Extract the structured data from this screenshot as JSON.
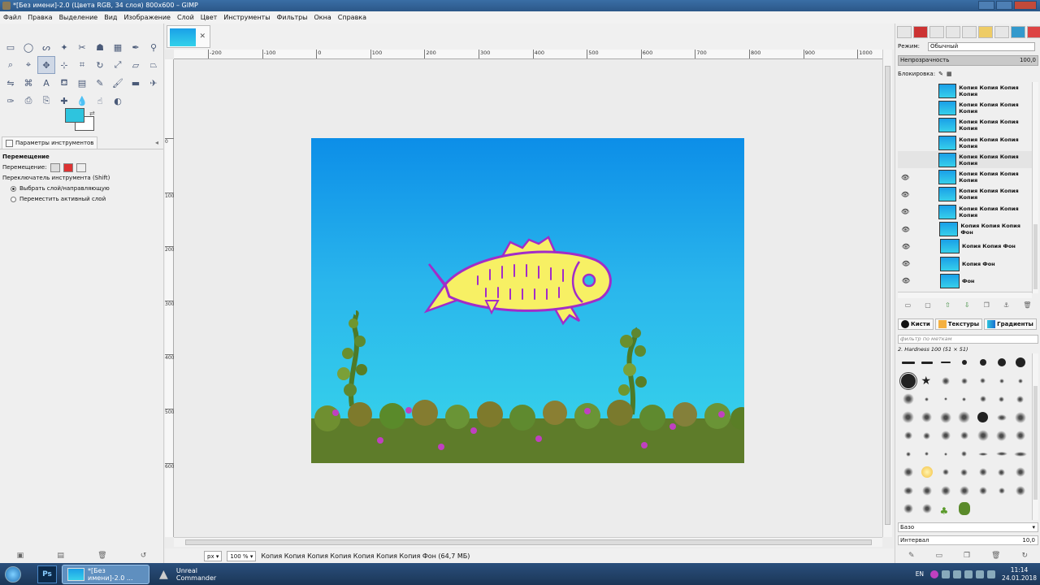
{
  "window": {
    "title": "*[Без имени]-2.0 (Цвета RGB, 34 слоя) 800x600 – GIMP"
  },
  "menu": [
    "Файл",
    "Правка",
    "Выделение",
    "Вид",
    "Изображение",
    "Слой",
    "Цвет",
    "Инструменты",
    "Фильтры",
    "Окна",
    "Справка"
  ],
  "toolbox": {
    "tools": [
      {
        "name": "rect-select-tool-icon",
        "glyph": "▭"
      },
      {
        "name": "ellipse-select-tool-icon",
        "glyph": "◯"
      },
      {
        "name": "free-select-tool-icon",
        "glyph": "ᔕ"
      },
      {
        "name": "fuzzy-select-tool-icon",
        "glyph": "✦"
      },
      {
        "name": "scissors-tool-icon",
        "glyph": "✂"
      },
      {
        "name": "foreground-select-tool-icon",
        "glyph": "☗"
      },
      {
        "name": "select-by-color-tool-icon",
        "glyph": "▦"
      },
      {
        "name": "paths-tool-icon",
        "glyph": "✒"
      },
      {
        "name": "color-picker-tool-icon",
        "glyph": "⚲"
      },
      {
        "name": "zoom-tool-icon",
        "glyph": "⌕"
      },
      {
        "name": "measure-tool-icon",
        "glyph": "⌖"
      },
      {
        "name": "move-tool-icon",
        "glyph": "✥"
      },
      {
        "name": "align-tool-icon",
        "glyph": "⊹"
      },
      {
        "name": "crop-tool-icon",
        "glyph": "⌗"
      },
      {
        "name": "rotate-tool-icon",
        "glyph": "↻"
      },
      {
        "name": "scale-tool-icon",
        "glyph": "⤢"
      },
      {
        "name": "shear-tool-icon",
        "glyph": "▱"
      },
      {
        "name": "perspective-tool-icon",
        "glyph": "⏢"
      },
      {
        "name": "flip-tool-icon",
        "glyph": "⇋"
      },
      {
        "name": "cage-tool-icon",
        "glyph": "⌘"
      },
      {
        "name": "text-tool-icon",
        "glyph": "A"
      },
      {
        "name": "bucket-fill-tool-icon",
        "glyph": "⛾"
      },
      {
        "name": "blend-tool-icon",
        "glyph": "▤"
      },
      {
        "name": "pencil-tool-icon",
        "glyph": "✎"
      },
      {
        "name": "paintbrush-tool-icon",
        "glyph": "🖌"
      },
      {
        "name": "eraser-tool-icon",
        "glyph": "▬"
      },
      {
        "name": "airbrush-tool-icon",
        "glyph": "✈"
      },
      {
        "name": "ink-tool-icon",
        "glyph": "✑"
      },
      {
        "name": "clone-tool-icon",
        "glyph": "⎙"
      },
      {
        "name": "perspective-clone-tool-icon",
        "glyph": "⎘"
      },
      {
        "name": "heal-tool-icon",
        "glyph": "✚"
      },
      {
        "name": "blur-tool-icon",
        "glyph": "💧"
      },
      {
        "name": "smudge-tool-icon",
        "glyph": "☝"
      },
      {
        "name": "dodge-burn-tool-icon",
        "glyph": "◐"
      }
    ],
    "fg_color": "#2ec4de",
    "bg_color": "#ffffff"
  },
  "tool_options": {
    "tab_label": "Параметры инструментов",
    "title": "Перемещение",
    "move_label": "Перемещение:",
    "toggle_label": "Переключатель инструмента  (Shift)",
    "option1": "Выбрать слой/направляющую",
    "option2": "Переместить активный слой"
  },
  "ruler": {
    "h_labels": [
      "-200",
      "-100",
      "0",
      "100",
      "200",
      "300",
      "400",
      "500",
      "600",
      "700",
      "800",
      "900",
      "1000"
    ],
    "v_labels": [
      "0",
      "100",
      "200",
      "300",
      "400",
      "500",
      "600"
    ]
  },
  "statusbar": {
    "unit": "px",
    "zoom": "100 %",
    "message": "Копия Копия Копия Копия Копия Копия Копия Фон (64,7 МБ)"
  },
  "layers_panel": {
    "mode_label": "Режим:",
    "mode_value": "Обычный",
    "opacity_label": "Непрозрачность",
    "opacity_value": "100,0",
    "lock_label": "Блокировка:",
    "layers": [
      {
        "name": "Копия Копия Копия Копия",
        "visible": false,
        "selected": false
      },
      {
        "name": "Копия Копия Копия Копия",
        "visible": false,
        "selected": false
      },
      {
        "name": "Копия Копия Копия Копия",
        "visible": false,
        "selected": false
      },
      {
        "name": "Копия Копия Копия Копия",
        "visible": false,
        "selected": false
      },
      {
        "name": "Копия Копия Копия Копия",
        "visible": false,
        "selected": true
      },
      {
        "name": "Копия Копия Копия Копия",
        "visible": true,
        "selected": false
      },
      {
        "name": "Копия Копия Копия Копия",
        "visible": true,
        "selected": false
      },
      {
        "name": "Копия Копия Копия Копия",
        "visible": true,
        "selected": false
      },
      {
        "name": "Копия Копия Копия Фон",
        "visible": true,
        "selected": false
      },
      {
        "name": "Копия Копия Фон",
        "visible": true,
        "selected": false
      },
      {
        "name": "Копия Фон",
        "visible": true,
        "selected": false
      },
      {
        "name": "Фон",
        "visible": true,
        "selected": false
      }
    ]
  },
  "brushes_panel": {
    "tabs": [
      "Кисти",
      "Текстуры",
      "Градиенты"
    ],
    "filter_placeholder": "фильтр по меткам",
    "brush_name": "2. Hardness 100 (51 × 51)",
    "preset_label": "Базо",
    "spacing_label": "Интервал",
    "spacing_value": "10,0"
  },
  "taskbar": {
    "ps_label": "Ps",
    "gimp_button": "*[Без имени]-2.0 ...",
    "uc_button": "Unreal Commander",
    "lang": "EN",
    "time": "11:14",
    "date": "24.01.2018"
  }
}
